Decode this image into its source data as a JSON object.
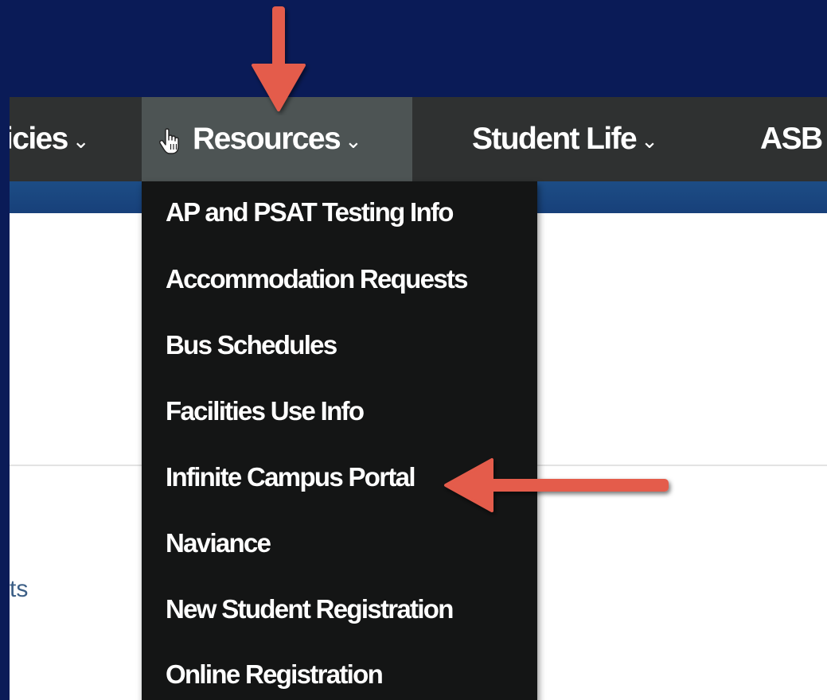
{
  "nav": {
    "items": [
      {
        "label": "icies",
        "chevron": "⌄"
      },
      {
        "label": "Resources",
        "chevron": "⌄"
      },
      {
        "label": "Student Life",
        "chevron": "⌄"
      },
      {
        "label": "ASB"
      }
    ],
    "active": "Resources"
  },
  "dropdown": {
    "items": [
      {
        "label": "AP and PSAT Testing Info"
      },
      {
        "label": "Accommodation Requests"
      },
      {
        "label": "Bus Schedules"
      },
      {
        "label": "Facilities Use Info"
      },
      {
        "label": "Infinite Campus Portal"
      },
      {
        "label": "Naviance"
      },
      {
        "label": "New Student Registration"
      },
      {
        "label": "Online Registration"
      }
    ]
  },
  "page": {
    "partial_text": "ts"
  },
  "annotations": {
    "arrow_color": "#e45b4b",
    "arrows": [
      "down-arrow-to-resources",
      "left-arrow-to-infinite-campus-portal"
    ]
  },
  "colors": {
    "slide_background": "#0a1b57",
    "navbar": "#2f3131",
    "nav_active": "#4d5454",
    "dropdown": "#141515",
    "band": "#1d4d85"
  },
  "icons": {
    "cursor": "hand-pointer-icon",
    "chevron": "chevron-down-icon"
  }
}
